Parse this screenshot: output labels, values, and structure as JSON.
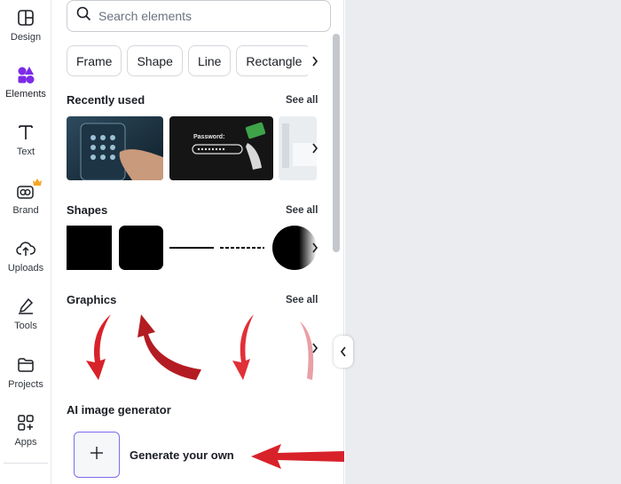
{
  "rail": {
    "items": [
      {
        "label": "Design",
        "icon": "layout-icon"
      },
      {
        "label": "Elements",
        "icon": "elements-icon"
      },
      {
        "label": "Text",
        "icon": "text-icon"
      },
      {
        "label": "Brand",
        "icon": "brand-icon"
      },
      {
        "label": "Uploads",
        "icon": "cloud-upload-icon"
      },
      {
        "label": "Tools",
        "icon": "pen-icon"
      },
      {
        "label": "Projects",
        "icon": "folder-icon"
      },
      {
        "label": "Apps",
        "icon": "apps-icon"
      }
    ],
    "active": "Elements"
  },
  "search": {
    "placeholder": "Search elements"
  },
  "chips": [
    "Frame",
    "Shape",
    "Line",
    "Rectangle"
  ],
  "sections": {
    "recent": {
      "title": "Recently used",
      "see_all": "See all"
    },
    "shapes": {
      "title": "Shapes",
      "see_all": "See all"
    },
    "graphics": {
      "title": "Graphics",
      "see_all": "See all"
    },
    "ai": {
      "title": "AI image generator",
      "action": "Generate your own"
    }
  },
  "thumbs": {
    "password_text": "Password:"
  },
  "colors": {
    "accent": "#7d6df0",
    "arrow_red": "#d8222a",
    "elements_icon": "#7d2ae8",
    "crown": "#f5a623"
  }
}
